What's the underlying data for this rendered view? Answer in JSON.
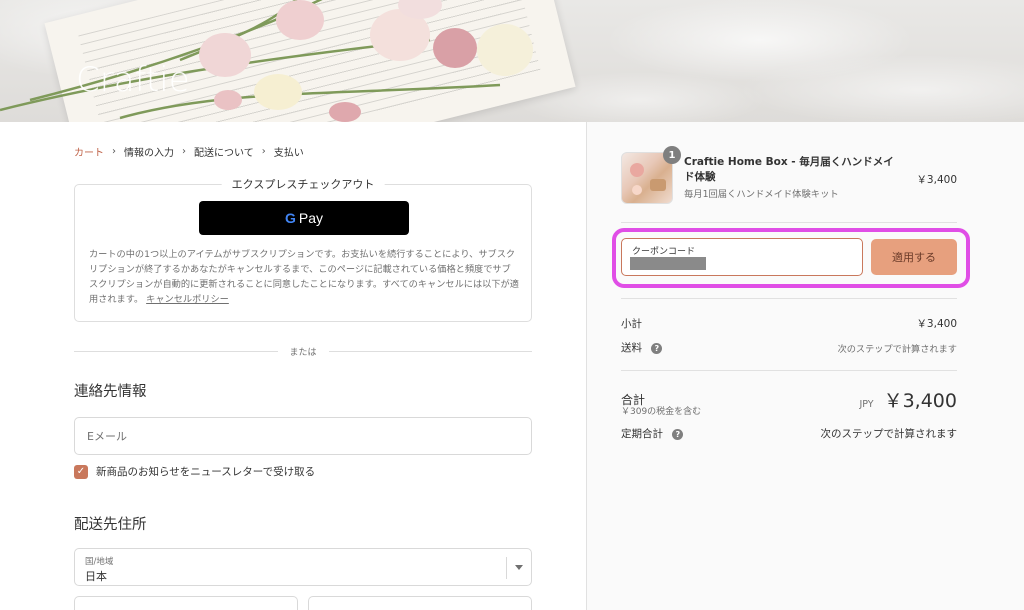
{
  "header": {
    "logo_text": "Craftie"
  },
  "breadcrumb": {
    "items": [
      "カート",
      "情報の入力",
      "配送について",
      "支払い"
    ]
  },
  "express_checkout": {
    "title": "エクスプレスチェックアウト",
    "gpay_label": "Pay",
    "gpay_g": "G",
    "disclaimer": "カートの中の1つ以上のアイテムがサブスクリプションです。お支払いを続行することにより、サブスクリプションが終了するかあなたがキャンセルするまで、このページに記載されている価格と頻度でサブスクリプションが自動的に更新されることに同意したことになります。すべてのキャンセルには以下が適用されます。",
    "policy_link": "キャンセルポリシー"
  },
  "or_divider": "または",
  "contact": {
    "title": "連絡先情報",
    "email_placeholder": "Eメール",
    "newsletter_label": "新商品のお知らせをニュースレターで受け取る",
    "newsletter_checked": true
  },
  "shipping": {
    "title": "配送先住所",
    "country_label": "国/地域",
    "country_value": "日本"
  },
  "summary": {
    "product": {
      "name": "Craftie Home Box - 毎月届くハンドメイド体験",
      "subtitle": "毎月1回届くハンドメイド体験キット",
      "price": "￥3,400",
      "quantity": "1"
    },
    "coupon": {
      "label": "クーポンコード",
      "apply_label": "適用する",
      "highlight_color": "#e04ee6"
    },
    "subtotal_label": "小計",
    "subtotal_value": "￥3,400",
    "shipping_label": "送料",
    "shipping_value": "次のステップで計算されます",
    "total_label": "合計",
    "tax_note": "￥309の税金を含む",
    "currency": "JPY",
    "total_value": "￥3,400",
    "recurring_label": "定期合計",
    "recurring_value": "次のステップで計算されます"
  },
  "colors": {
    "accent": "#c9785c",
    "apply_button": "#e7a07e",
    "highlight": "#e04ee6"
  }
}
